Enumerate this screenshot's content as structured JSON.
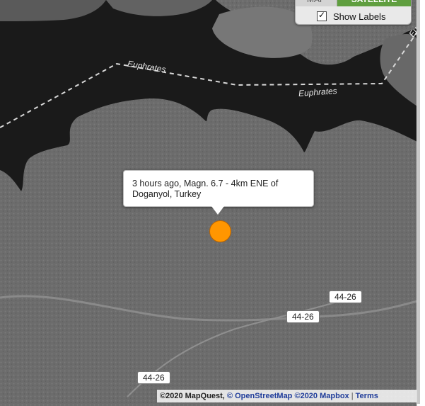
{
  "map": {
    "type": "satellite-map",
    "colors": {
      "water": "#1a1a1a",
      "land": "#6e6e6e",
      "marker": "#ff9600",
      "active_tab": "#5f9e3f"
    }
  },
  "layer_control": {
    "tabs": [
      {
        "label": "MAP",
        "active": false
      },
      {
        "label": "SATELLITE",
        "active": true
      }
    ],
    "show_labels": {
      "label": "Show Labels",
      "checked": true
    }
  },
  "popup": {
    "text": "3 hours ago, Magn. 6.7 - 4km ENE of Doganyol, Turkey"
  },
  "marker": {
    "icon": "earthquake-circle-icon"
  },
  "river_labels": [
    "Euphrates",
    "Euphrates",
    "Eu"
  ],
  "road_shields": [
    "44-26",
    "44-26",
    "44-26"
  ],
  "attribution": {
    "mapquest": "©2020 MapQuest,",
    "copyright_symbol": "©",
    "osm_link": "OpenStreetMap",
    "mapbox_link": "©2020 Mapbox",
    "separator": "|",
    "terms_link": "Terms"
  }
}
